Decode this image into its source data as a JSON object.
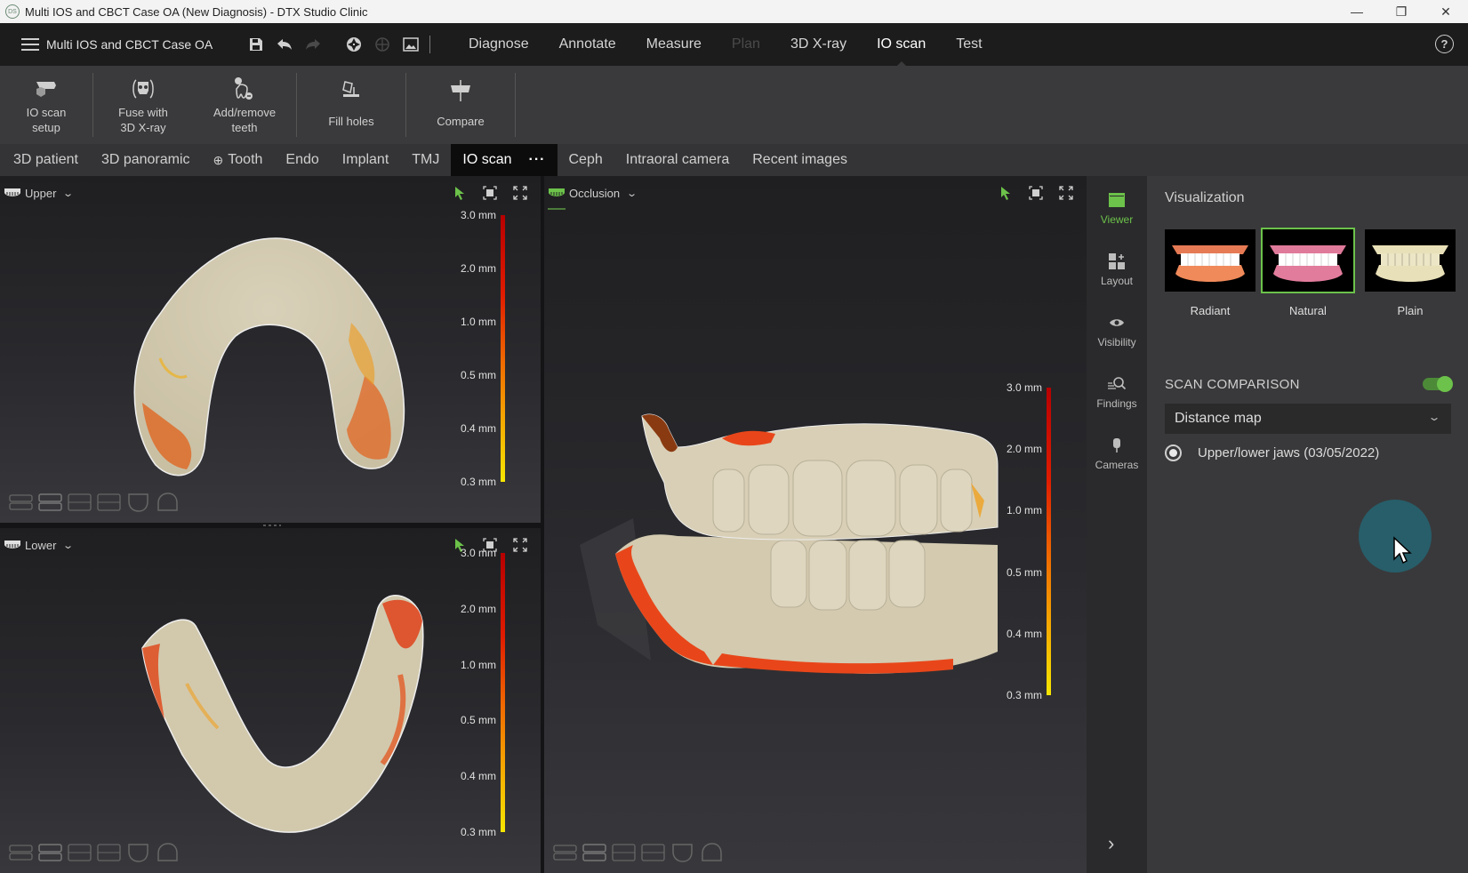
{
  "window": {
    "title": "Multi IOS and CBCT Case OA (New Diagnosis) - DTX Studio Clinic",
    "controls": [
      "minimize",
      "restore",
      "close"
    ]
  },
  "menubar": {
    "case_name": "Multi IOS and CBCT Case OA",
    "quick_tools": [
      {
        "name": "save-icon",
        "enabled": true
      },
      {
        "name": "undo-icon",
        "enabled": true
      },
      {
        "name": "redo-icon",
        "enabled": false
      },
      {
        "name": "aperture-icon",
        "enabled": true
      },
      {
        "name": "crosshair-icon",
        "enabled": false
      },
      {
        "name": "screenshot-icon",
        "enabled": true
      }
    ],
    "items": [
      {
        "label": "Diagnose",
        "state": "normal"
      },
      {
        "label": "Annotate",
        "state": "normal"
      },
      {
        "label": "Measure",
        "state": "normal"
      },
      {
        "label": "Plan",
        "state": "disabled"
      },
      {
        "label": "3D X-ray",
        "state": "normal"
      },
      {
        "label": "IO scan",
        "state": "active"
      },
      {
        "label": "Test",
        "state": "normal"
      }
    ],
    "help_label": "?"
  },
  "ribbon": {
    "buttons": [
      {
        "line1": "IO scan",
        "line2": "setup"
      },
      {
        "line1": "Fuse with",
        "line2": "3D X-ray"
      },
      {
        "line1": "Add/remove",
        "line2": "teeth"
      },
      {
        "line1": "Fill holes",
        "line2": ""
      },
      {
        "line1": "Compare",
        "line2": ""
      }
    ]
  },
  "tabs": {
    "items": [
      {
        "label": "3D patient"
      },
      {
        "label": "3D panoramic"
      },
      {
        "label": "Tooth",
        "icon": "tooth-target-icon"
      },
      {
        "label": "Endo"
      },
      {
        "label": "Implant"
      },
      {
        "label": "TMJ"
      },
      {
        "label": "IO scan",
        "active": true,
        "more": "···"
      },
      {
        "label": "Ceph"
      },
      {
        "label": "Intraoral camera"
      },
      {
        "label": "Recent images"
      }
    ]
  },
  "viewports": {
    "upper": {
      "title": "Upper"
    },
    "lower": {
      "title": "Lower"
    },
    "occlusion": {
      "title": "Occlusion"
    },
    "scale_labels": [
      "3.0 mm",
      "2.0 mm",
      "1.0 mm",
      "0.5 mm",
      "0.4 mm",
      "0.3 mm"
    ]
  },
  "rail": {
    "items": [
      {
        "label": "Viewer",
        "active": true
      },
      {
        "label": "Layout"
      },
      {
        "label": "Visibility"
      },
      {
        "label": "Findings"
      },
      {
        "label": "Cameras"
      }
    ]
  },
  "panel": {
    "title": "Visualization",
    "styles": [
      {
        "label": "Radiant",
        "selected": false
      },
      {
        "label": "Natural",
        "selected": true
      },
      {
        "label": "Plain",
        "selected": false
      }
    ],
    "scan_comparison": {
      "title": "SCAN COMPARISON",
      "enabled": true,
      "mode": "Distance map",
      "option": "Upper/lower jaws (03/05/2022)",
      "option_selected": true
    }
  },
  "colors": {
    "accent": "#6cc24a",
    "scale_high": "#b80000",
    "scale_low": "#f7e600",
    "cursor_halo": "#275e6a"
  }
}
